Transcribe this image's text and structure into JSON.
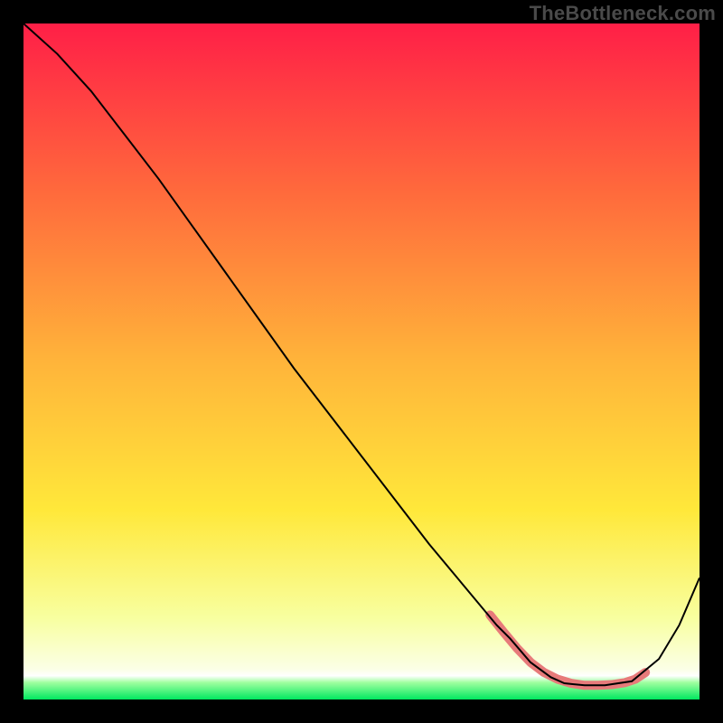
{
  "watermark": "TheBottleneck.com",
  "chart_data": {
    "type": "line",
    "title": "",
    "xlabel": "",
    "ylabel": "",
    "xlim": [
      0,
      100
    ],
    "ylim": [
      0,
      100
    ],
    "grid": false,
    "legend": false,
    "gradient_stops": [
      {
        "offset": 0,
        "color": "#ff1f47"
      },
      {
        "offset": 0.25,
        "color": "#ff6a3c"
      },
      {
        "offset": 0.5,
        "color": "#ffb43a"
      },
      {
        "offset": 0.72,
        "color": "#ffe83a"
      },
      {
        "offset": 0.88,
        "color": "#f8ffa0"
      },
      {
        "offset": 0.955,
        "color": "#fbffe6"
      },
      {
        "offset": 0.965,
        "color": "#ffffff"
      },
      {
        "offset": 0.975,
        "color": "#9fff9f"
      },
      {
        "offset": 1.0,
        "color": "#00e85f"
      }
    ],
    "series": [
      {
        "name": "bottleneck-curve",
        "color": "#000000",
        "x": [
          0,
          5,
          10,
          15,
          20,
          25,
          30,
          35,
          40,
          45,
          50,
          55,
          60,
          65,
          70,
          72,
          75,
          78,
          80,
          83,
          86,
          90,
          94,
          97,
          100
        ],
        "y": [
          100,
          95.5,
          90,
          83.5,
          77,
          70,
          63,
          56,
          49,
          42.5,
          36,
          29.5,
          23,
          17,
          11,
          9,
          5.5,
          3.3,
          2.4,
          2.1,
          2.1,
          2.7,
          6,
          11,
          18
        ]
      }
    ],
    "highlight": {
      "name": "optimal-zone",
      "color": "#e77a7a",
      "stroke_width": 10,
      "x": [
        69,
        71,
        73,
        75,
        77,
        79,
        81,
        83,
        85,
        87,
        89,
        90.5,
        92
      ],
      "y": [
        12.5,
        10,
        7.6,
        5.5,
        4,
        3.0,
        2.4,
        2.1,
        2.1,
        2.2,
        2.5,
        3.0,
        4.0
      ]
    }
  }
}
